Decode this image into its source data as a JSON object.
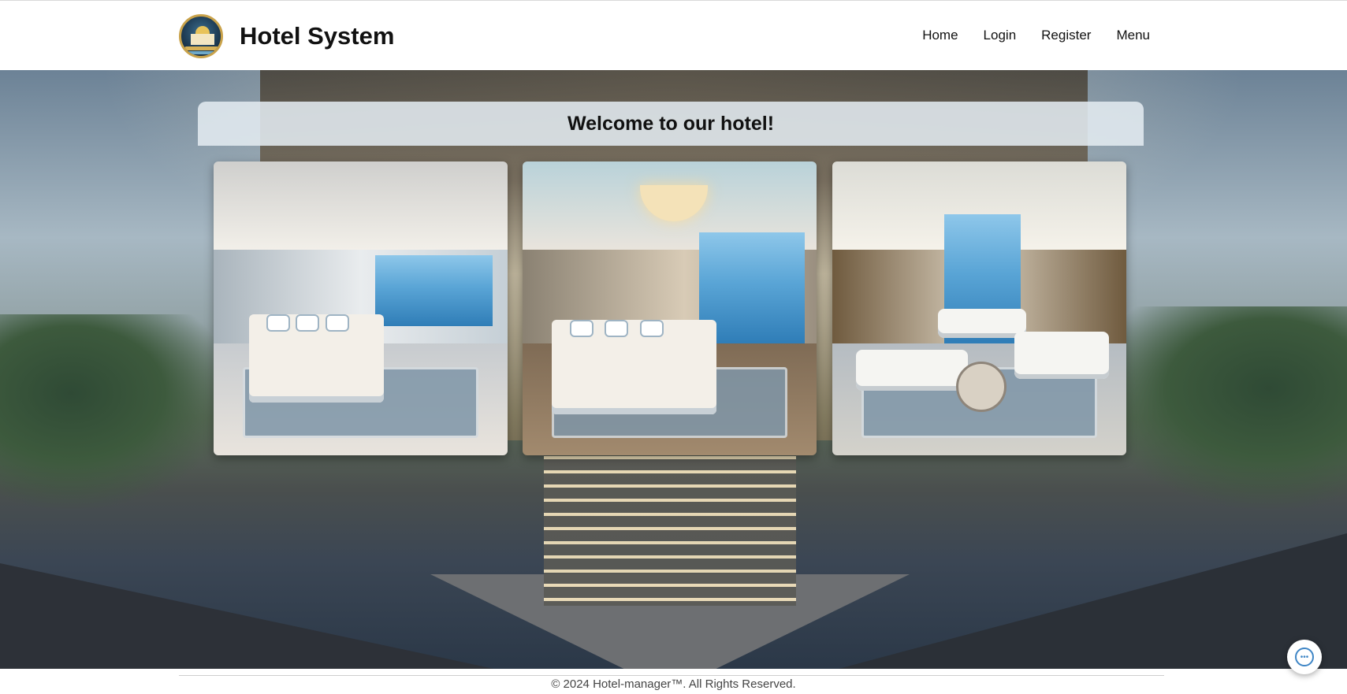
{
  "header": {
    "site_title": "Hotel System",
    "logo_icon": "hotel-logo-icon",
    "nav": [
      {
        "label": "Home"
      },
      {
        "label": "Login"
      },
      {
        "label": "Register"
      },
      {
        "label": "Menu"
      }
    ]
  },
  "hero": {
    "welcome_heading": "Welcome to our hotel!",
    "gallery": [
      {
        "name": "bedroom-sea-view-photo"
      },
      {
        "name": "suite-bedroom-photo"
      },
      {
        "name": "lobby-lounge-photo"
      }
    ]
  },
  "footer": {
    "text": "© 2024 Hotel-manager™. All Rights Reserved."
  },
  "chat_widget": {
    "icon": "chat-bubble-icon",
    "glyph": "•••"
  },
  "colors": {
    "logo_gold": "#c9a24a",
    "logo_navy": "#1f3d56",
    "chat_blue": "#3f86c6"
  }
}
